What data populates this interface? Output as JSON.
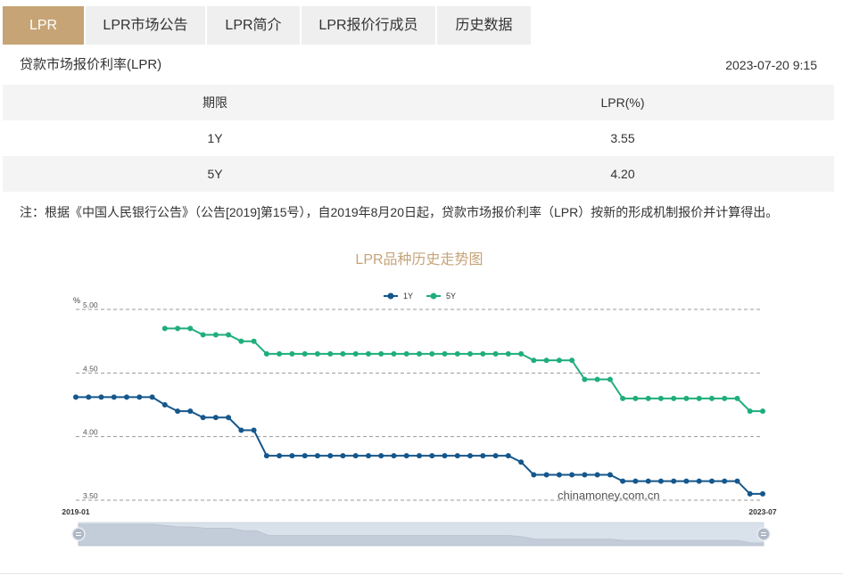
{
  "tabs": [
    {
      "label": "LPR",
      "active": true
    },
    {
      "label": "LPR市场公告",
      "active": false
    },
    {
      "label": "LPR简介",
      "active": false
    },
    {
      "label": "LPR报价行成员",
      "active": false
    },
    {
      "label": "历史数据",
      "active": false
    }
  ],
  "header": {
    "title": "贷款市场报价利率(LPR)",
    "updated": "2023-07-20 9:15"
  },
  "table": {
    "columns": [
      "期限",
      "LPR(%)"
    ],
    "rows": [
      {
        "term": "1Y",
        "rate": "3.55"
      },
      {
        "term": "5Y",
        "rate": "4.20"
      }
    ]
  },
  "note": "注：根据《中国人民银行公告》（公告[2019]第15号），自2019年8月20日起，贷款市场报价利率（LPR）按新的形成机制报价并计算得出。",
  "colors": {
    "accent": "#c6a475",
    "tab_inactive": "#efefef",
    "row_shade": "#f4f4f4",
    "chart_title": "#c5a47a"
  },
  "chart_data": {
    "type": "line",
    "title": "LPR品种历史走势图",
    "ylabel": "%",
    "ylim": [
      3.5,
      5.0
    ],
    "yticks": [
      "5.00",
      "4.50",
      "4.00",
      "3.50"
    ],
    "xticks": [
      "2019-01",
      "2023-07"
    ],
    "grid": true,
    "legend": "top",
    "watermark": "chinamoney.com.cn",
    "zoom": {
      "start": 0,
      "end": 100
    },
    "x": [
      "2019-01",
      "2019-02",
      "2019-03",
      "2019-04",
      "2019-05",
      "2019-06",
      "2019-07",
      "2019-08",
      "2019-09",
      "2019-10",
      "2019-11",
      "2019-12",
      "2020-01",
      "2020-02",
      "2020-03",
      "2020-04",
      "2020-05",
      "2020-06",
      "2020-07",
      "2020-08",
      "2020-09",
      "2020-10",
      "2020-11",
      "2020-12",
      "2021-01",
      "2021-02",
      "2021-03",
      "2021-04",
      "2021-05",
      "2021-06",
      "2021-07",
      "2021-08",
      "2021-09",
      "2021-10",
      "2021-11",
      "2021-12",
      "2022-01",
      "2022-02",
      "2022-03",
      "2022-04",
      "2022-05",
      "2022-06",
      "2022-07",
      "2022-08",
      "2022-09",
      "2022-10",
      "2022-11",
      "2022-12",
      "2023-01",
      "2023-02",
      "2023-03",
      "2023-04",
      "2023-05",
      "2023-06",
      "2023-07"
    ],
    "series": [
      {
        "name": "1Y",
        "color": "#15578c",
        "values": [
          4.31,
          4.31,
          4.31,
          4.31,
          4.31,
          4.31,
          4.31,
          4.25,
          4.2,
          4.2,
          4.15,
          4.15,
          4.15,
          4.05,
          4.05,
          3.85,
          3.85,
          3.85,
          3.85,
          3.85,
          3.85,
          3.85,
          3.85,
          3.85,
          3.85,
          3.85,
          3.85,
          3.85,
          3.85,
          3.85,
          3.85,
          3.85,
          3.85,
          3.85,
          3.85,
          3.8,
          3.7,
          3.7,
          3.7,
          3.7,
          3.7,
          3.7,
          3.7,
          3.65,
          3.65,
          3.65,
          3.65,
          3.65,
          3.65,
          3.65,
          3.65,
          3.65,
          3.65,
          3.55,
          3.55
        ]
      },
      {
        "name": "5Y",
        "color": "#1fae7b",
        "values": [
          null,
          null,
          null,
          null,
          null,
          null,
          null,
          4.85,
          4.85,
          4.85,
          4.8,
          4.8,
          4.8,
          4.75,
          4.75,
          4.65,
          4.65,
          4.65,
          4.65,
          4.65,
          4.65,
          4.65,
          4.65,
          4.65,
          4.65,
          4.65,
          4.65,
          4.65,
          4.65,
          4.65,
          4.65,
          4.65,
          4.65,
          4.65,
          4.65,
          4.65,
          4.6,
          4.6,
          4.6,
          4.6,
          4.45,
          4.45,
          4.45,
          4.3,
          4.3,
          4.3,
          4.3,
          4.3,
          4.3,
          4.3,
          4.3,
          4.3,
          4.3,
          4.2,
          4.2
        ]
      }
    ]
  }
}
